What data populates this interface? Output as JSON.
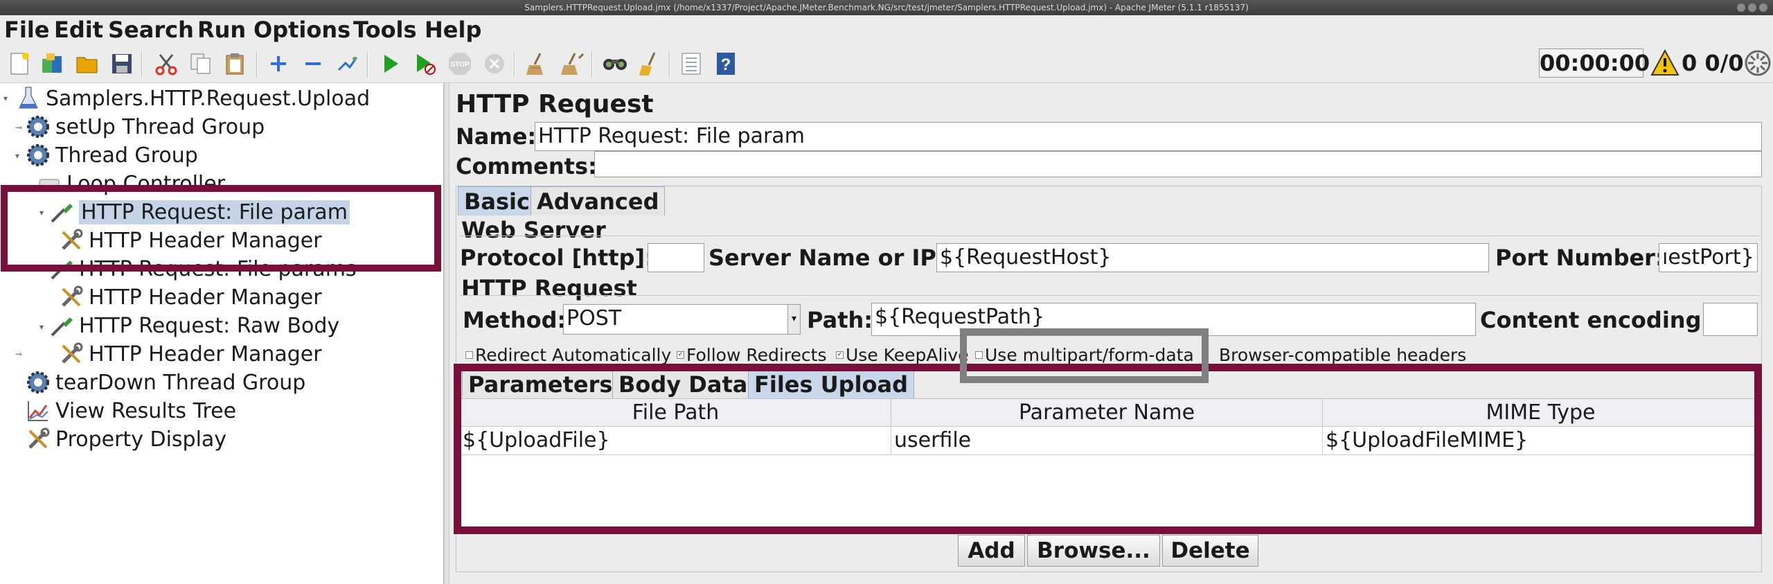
{
  "window": {
    "title": "Samplers.HTTPRequest.Upload.jmx (/home/x1337/Project/Apache.JMeter.Benchmark.NG/src/test/jmeter/Samplers.HTTPRequest.Upload.jmx) - Apache JMeter (5.1.1 r1855137)"
  },
  "menu": [
    "File",
    "Edit",
    "Search",
    "Run",
    "Options",
    "Tools",
    "Help"
  ],
  "toolbar": {
    "icons": [
      "new-icon",
      "templates-icon",
      "open-icon",
      "save-icon",
      "cut-icon",
      "copy-icon",
      "paste-icon",
      "expand-icon",
      "collapse-icon",
      "toggle-icon",
      "start-icon",
      "start-no-pause-icon",
      "stop-icon",
      "shutdown-icon",
      "clear-icon",
      "clear-all-icon",
      "search-icon",
      "reset-search-icon",
      "function-helper-icon",
      "help-icon"
    ],
    "timer": "00:00:00",
    "status": "0 0/0"
  },
  "tree": [
    {
      "label": "Samplers.HTTP.Request.Upload",
      "icon": "test-plan-icon"
    },
    {
      "label": "setUp Thread Group",
      "icon": "gear-icon"
    },
    {
      "label": "Thread Group",
      "icon": "gear-icon"
    },
    {
      "label": "Loop Controller",
      "icon": "loop-icon"
    },
    {
      "label": "HTTP Request: File param",
      "icon": "pipette-icon"
    },
    {
      "label": "HTTP Header Manager",
      "icon": "wrench-icon"
    },
    {
      "label": "HTTP Request: File params",
      "icon": "pipette-icon"
    },
    {
      "label": "HTTP Header Manager",
      "icon": "wrench-icon"
    },
    {
      "label": "HTTP Request: Raw Body",
      "icon": "pipette-icon"
    },
    {
      "label": "HTTP Header Manager",
      "icon": "wrench-icon"
    },
    {
      "label": "tearDown Thread Group",
      "icon": "gear-icon"
    },
    {
      "label": "View Results Tree",
      "icon": "chart-icon"
    },
    {
      "label": "Property Display",
      "icon": "wrench-icon"
    }
  ],
  "panel": {
    "heading": "HTTP Request",
    "name_label": "Name:",
    "name_value": "HTTP Request: File param",
    "comments_label": "Comments:",
    "comments_value": "",
    "tabs": [
      "Basic",
      "Advanced"
    ],
    "web_server_title": "Web Server",
    "protocol_label": "Protocol [http]:",
    "protocol_value": "",
    "server_label": "Server Name or IP:",
    "server_value": "${RequestHost}",
    "port_label": "Port Number:",
    "port_value": "ıestPort}",
    "http_request_title": "HTTP Request",
    "method_label": "Method:",
    "method_value": "POST",
    "path_label": "Path:",
    "path_value": "${RequestPath}",
    "encoding_label": "Content encoding:",
    "encoding_value": "",
    "checkboxes": [
      {
        "label": "Redirect Automatically",
        "checked": false
      },
      {
        "label": "Follow Redirects",
        "checked": true
      },
      {
        "label": "Use KeepAlive",
        "checked": true
      },
      {
        "label": "Use multipart/form-data",
        "checked": false
      },
      {
        "label": "Browser-compatible headers",
        "checked": false
      }
    ],
    "sub_tabs": [
      "Parameters",
      "Body Data",
      "Files Upload"
    ],
    "files_table": {
      "columns": [
        "File Path",
        "Parameter Name",
        "MIME Type"
      ],
      "rows": [
        [
          "${UploadFile}",
          "userfile",
          "${UploadFileMIME}"
        ]
      ]
    },
    "buttons": [
      "Add",
      "Browse...",
      "Delete"
    ]
  },
  "colors": {
    "highlight": "#7a0e3b",
    "gray_highlight": "#7f7f7f",
    "selection": "#c5d3e8"
  }
}
